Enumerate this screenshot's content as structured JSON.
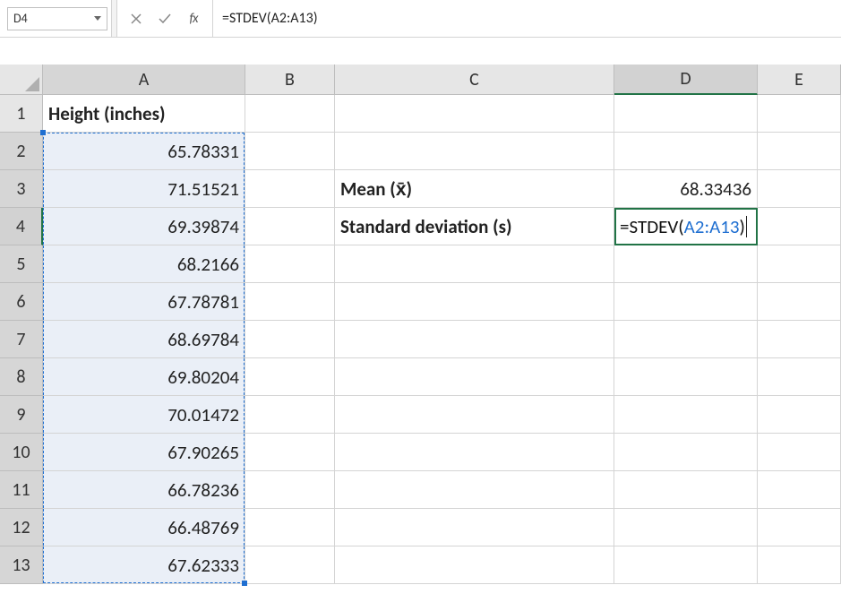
{
  "formula_bar": {
    "name_box": "D4",
    "formula": "=STDEV(A2:A13)"
  },
  "columns": [
    "A",
    "B",
    "C",
    "D",
    "E"
  ],
  "rows": [
    "1",
    "2",
    "3",
    "4",
    "5",
    "6",
    "7",
    "8",
    "9",
    "10",
    "11",
    "12",
    "13"
  ],
  "header_a1": "Height (inches)",
  "heights": [
    "65.78331",
    "71.51521",
    "69.39874",
    "68.2166",
    "67.78781",
    "68.69784",
    "69.80204",
    "70.01472",
    "67.90265",
    "66.78236",
    "66.48769",
    "67.62333"
  ],
  "labels": {
    "mean": "Mean (x̄)",
    "sd": "Standard deviation (s)"
  },
  "mean_value": "68.33436",
  "edit_parts": {
    "prefix": "=STDEV(",
    "ref": "A2:A13",
    "suffix": ")"
  }
}
